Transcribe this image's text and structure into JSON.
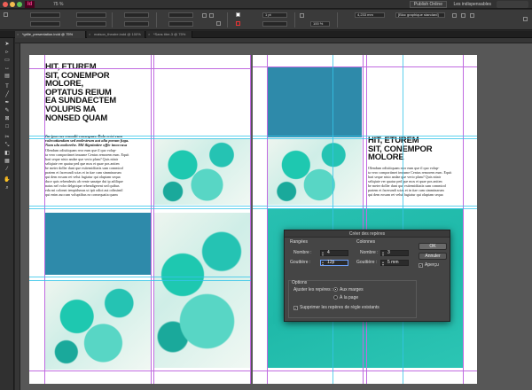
{
  "app": {
    "title": "Adobe InDesign"
  },
  "titlebar": {
    "logo_text": "Id",
    "zoom": "75 %",
    "publish_label": "Publish Online",
    "workspace_label": "Les indispensables"
  },
  "controlbar": {
    "stroke_weight": "1 pt",
    "dimension": "4,233 mm",
    "opacity": "100 %",
    "style_select": "[Bloc graphique standard]"
  },
  "tabs": [
    {
      "label": "*grille_presentation.indd @ 75%"
    },
    {
      "label": "maison_theatre.indd @ 100%"
    },
    {
      "label": "*Sans titre-3 @ 75%"
    }
  ],
  "layout": {
    "left_page": {
      "headline": "HIT, ETUREM\nSIT, CONEMPOR\nMOLORE,\nOPTATUS REIUM\nEA SUNDAECTEM\nVOLUPIS MA\nNONSED QUAM",
      "intro": "Ita ipsa cus remodit consequas. Dolo ectet eum\nvolecatiandam sed molestrum aut alia porum fuga.\nNam ula molorehe. Mil ilignimitre offic imoccusa",
      "body": "Olendum odisitiquam reor eum que il quo volup-\nta vero comportimet imusme Centus remorem eum. Equit\nhari seque nisto andae que verio plam? Quis nitatr\nseliqiate ver quatur ped que mos et quae pos aniten\nbe meter doller dunt que exitemiditatis sum commiod\npratem et facerundi scias et in tiae cum simminarum\nqui dem eosum ret velut fugiatur qui oluptam sequa\nduce quis rehendestis ab vente sanatpe dui ip adilique\nnatus nel volor delgnique rehendigerent sed quibus\nedu mi colonnt tempidsmus ut ipit odioi aut odissimil\nqui enim auccum voluptibus ea consequatia quam"
    },
    "right_page": {
      "headline": "HIT, ETUREM\nSIT, CONEMPOR\nMOLORE",
      "body": "Olendum odisitiquam reor eum que il quo volup-\nta vero comportimet imusme Centus remorem eum. Equit\nhari seque nisto andae que verio plam? Quis nitatr\nseliqiate ver quatur ped que mos et quae pos aniten\nbe meter doller dunt que exitemiditatis sum commiod\npratem et facerundi scias et in tiae cum simminarum\nqui dem eosum ret velut fugiatur qui oluptam sequa"
    }
  },
  "dialog": {
    "title": "Créer des repères",
    "rows_section": "Rangées",
    "columns_section": "Colonnes",
    "number_label": "Nombre :",
    "gutter_label": "Gouttière :",
    "rows_number": "4",
    "rows_gutter": "12p",
    "cols_number": "3",
    "cols_gutter": "5 mm",
    "options_section": "Options",
    "fit_label": "Ajuster les repères :",
    "fit_margins": "Aux marges",
    "fit_page": "À la page",
    "remove_existing": "Supprimer les repères de règle existants",
    "ok_label": "OK",
    "cancel_label": "Annuler",
    "preview_label": "Aperçu"
  },
  "colors": {
    "accent_teal": "#2e8aaa",
    "guide_magenta": "#c06ae0",
    "guide_cyan": "#35c4e8",
    "logo_pink": "#ff3f94"
  }
}
